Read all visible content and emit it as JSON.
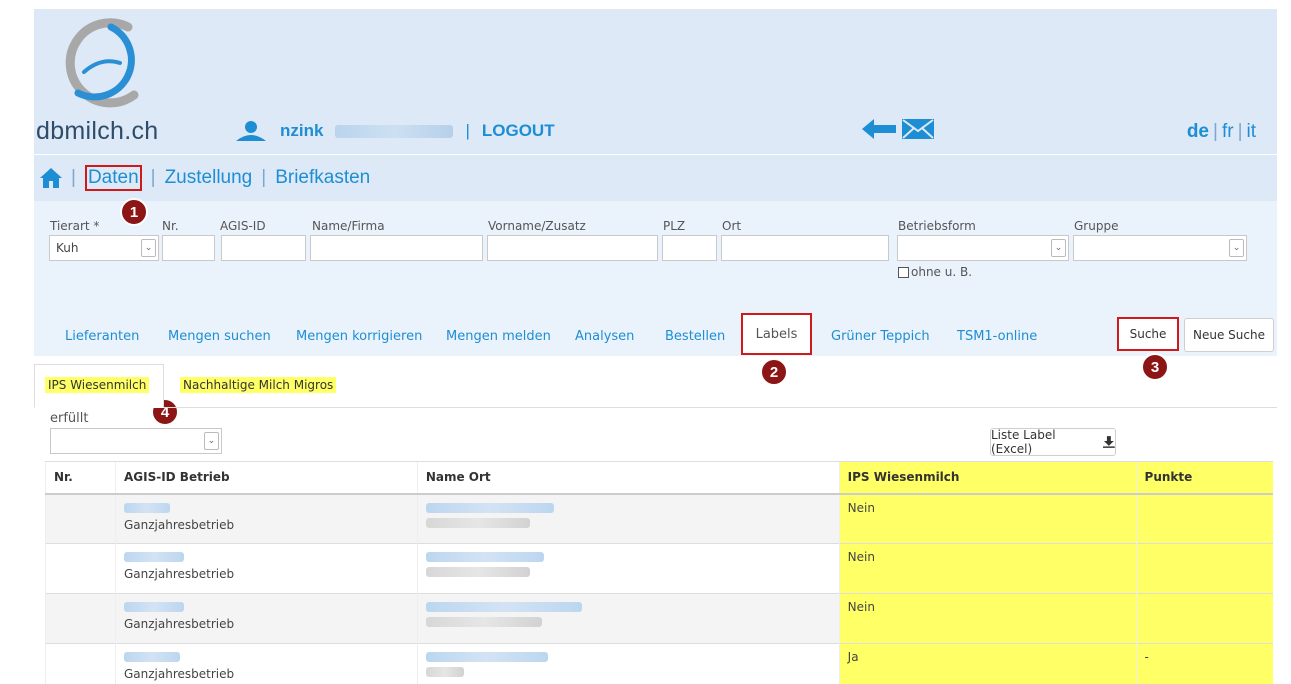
{
  "header": {
    "logo_text": "dbmilch.ch",
    "user": {
      "name": "nzink",
      "logout": "LOGOUT",
      "separator": "|"
    },
    "languages": {
      "de": "de",
      "fr": "fr",
      "it": "it"
    }
  },
  "menu": {
    "daten": "Daten",
    "zustellung": "Zustellung",
    "briefkasten": "Briefkasten",
    "separator": "|"
  },
  "filters": {
    "tierart_label": "Tierart *",
    "tierart_value": "Kuh",
    "nr_label": "Nr.",
    "agis_label": "AGIS-ID",
    "name_label": "Name/Firma",
    "vorname_label": "Vorname/Zusatz",
    "plz_label": "PLZ",
    "ort_label": "Ort",
    "betriebsform_label": "Betriebsform",
    "gruppe_label": "Gruppe",
    "ohne_label": "ohne u. B."
  },
  "tabs": {
    "lieferanten": "Lieferanten",
    "mengen_suchen": "Mengen suchen",
    "mengen_korrigieren": "Mengen korrigieren",
    "mengen_melden": "Mengen melden",
    "analysen": "Analysen",
    "bestellen": "Bestellen",
    "labels": "Labels",
    "gruener_teppich": "Grüner Teppich",
    "tsm1": "TSM1-online",
    "suche": "Suche",
    "neue_suche": "Neue Suche"
  },
  "badges": {
    "b1": "1",
    "b2": "2",
    "b3": "3",
    "b4": "4"
  },
  "subtabs": {
    "ips": "IPS Wiesenmilch",
    "migros": "Nachhaltige Milch Migros"
  },
  "erfuellt_label": "erfüllt",
  "excel_button": "Liste Label (Excel)",
  "table": {
    "headers": {
      "nr": "Nr.",
      "agis": "AGIS-ID Betrieb",
      "name_ort": "Name Ort",
      "ips": "IPS Wiesenmilch",
      "punkte": "Punkte"
    },
    "rows": [
      {
        "betrieb": "Ganzjahresbetrieb",
        "ips": "Nein",
        "punkte": ""
      },
      {
        "betrieb": "Ganzjahresbetrieb",
        "ips": "Nein",
        "punkte": ""
      },
      {
        "betrieb": "Ganzjahresbetrieb",
        "ips": "Nein",
        "punkte": ""
      },
      {
        "betrieb": "Ganzjahresbetrieb",
        "ips": "Ja",
        "punkte": "-"
      }
    ]
  },
  "colors": {
    "accent": "#1e8ed4",
    "header_bg": "#dde9f6",
    "highlight": "#ffff66",
    "badge": "#8c1515",
    "annotation_red": "#d01a1a"
  }
}
